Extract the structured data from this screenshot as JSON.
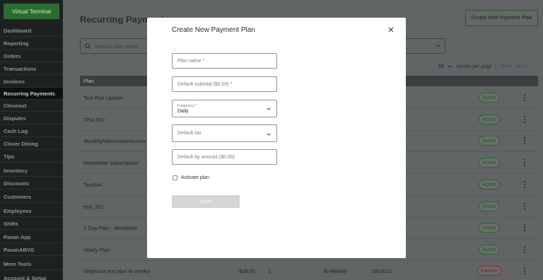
{
  "sidebar": {
    "virtual_terminal": "Virtual Terminal",
    "items": [
      {
        "label": "Dashboard"
      },
      {
        "label": "Reporting"
      },
      {
        "label": "Orders"
      },
      {
        "label": "Transactions"
      },
      {
        "label": "Invoices"
      },
      {
        "label": "Recurring Payments"
      },
      {
        "label": "Closeout"
      },
      {
        "label": "Disputes"
      },
      {
        "label": "Cash Log"
      },
      {
        "label": "Clover Dining"
      },
      {
        "label": "Tips"
      },
      {
        "label": "Inventory"
      },
      {
        "label": "Discounts"
      },
      {
        "label": "Customers"
      },
      {
        "label": "Employees"
      },
      {
        "label": "Shifts"
      },
      {
        "label": "Pavan App"
      },
      {
        "label": "PavanABVG"
      },
      {
        "label": "More Tools"
      },
      {
        "label": "Account & Setup"
      }
    ]
  },
  "main": {
    "title": "Recurring Payments",
    "create_button": "Create New Payment Plan",
    "search_placeholder": "Search plan name",
    "pager": {
      "per_page_value": "50",
      "per_page_label": "results per page",
      "prev": "‹ Prev",
      "next": "Next ›"
    },
    "table_header": "Plan",
    "rows": [
      {
        "name": "Test Run Update",
        "status": "Active"
      },
      {
        "name": "TEst 500",
        "status": "Active"
      },
      {
        "name": "abcdefghijklmnopqrstuvwx",
        "status": "Active"
      },
      {
        "name": "Newsletter subscription",
        "status": "Active"
      },
      {
        "name": "Test444",
        "status": "Active"
      },
      {
        "name": "test_321",
        "status": "Active"
      },
      {
        "name": "1 Day Plan - developer",
        "status": "Active"
      },
      {
        "name": "Yearly Plan",
        "status": "Active"
      },
      {
        "name": "Meghana test plan bi weekly",
        "amount": "$20.00",
        "count": "1",
        "frequency": "Bi-Weekly",
        "date": "10/16/21",
        "status": "Inactive"
      }
    ]
  },
  "modal": {
    "title": "Create New Payment Plan",
    "plan_name_placeholder": "Plan name *",
    "subtotal_placeholder": "Default subtotal ($0.00) *",
    "frequency_label": "Frequency *",
    "frequency_value": "Daily",
    "tax_placeholder": "Default tax",
    "tip_placeholder": "Default tip amount ($0.00)",
    "activate_label": "Activate plan",
    "save_label": "Save"
  },
  "colors": {
    "accent": "#2b6d2f",
    "active_badge": "#1f6b26",
    "inactive_badge": "#8a2a2a"
  }
}
